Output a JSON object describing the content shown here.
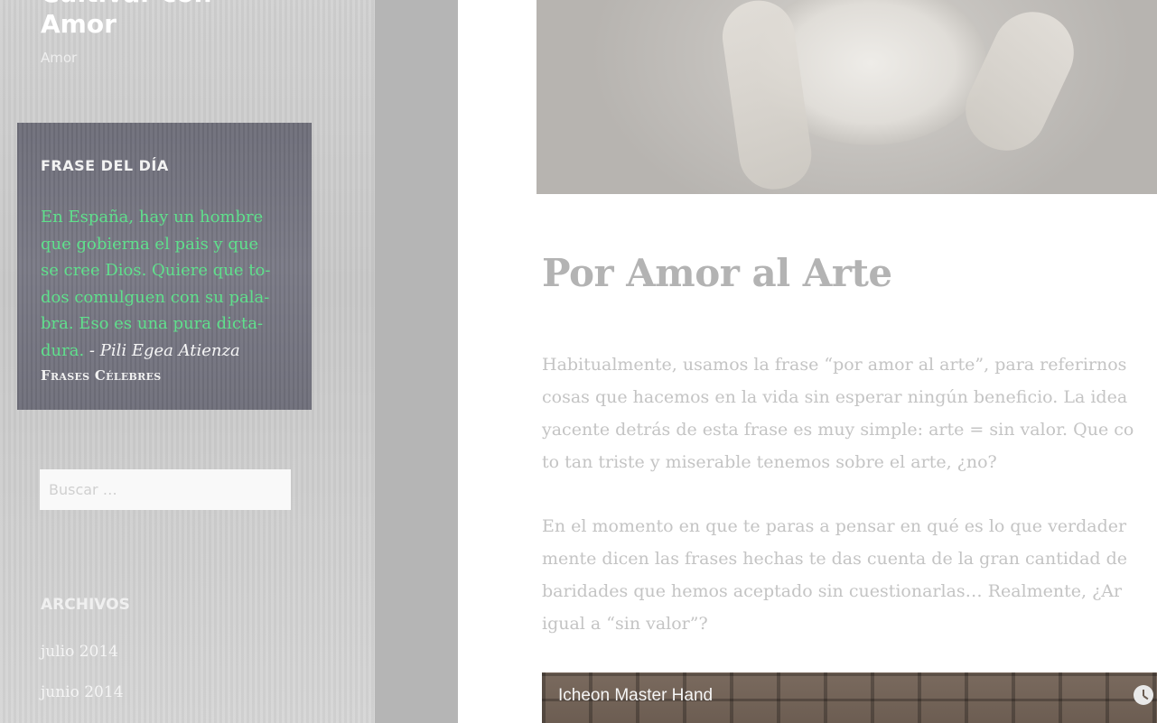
{
  "site": {
    "title_line1": "Cultivar con",
    "title_line2": "Amor",
    "description": "Amor"
  },
  "quote_widget": {
    "title": "FRASE DEL DÍA",
    "quote_lines": [
      "En España, hay un hombre",
      "que gobierna el pais y que",
      "se cree Dios. Quiere que to-",
      "dos comulguen con su pala-",
      "bra. Eso es una pura dicta-",
      "dura."
    ],
    "author": " - Pili Egea Atienza",
    "source": "Frases Célebres"
  },
  "search": {
    "placeholder": "Buscar …"
  },
  "archives": {
    "title": "ARCHIVOS",
    "items": [
      "julio 2014",
      "junio 2014"
    ]
  },
  "post": {
    "title": "Por Amor al Arte",
    "paragraph1_lines": [
      "Habitualmente, usamos la frase “por amor al arte”, para referirnos",
      "cosas que hacemos en la vida sin esperar ningún beneficio. La idea",
      "yacente detrás de esta frase es muy simple: arte = sin valor. Que co",
      "to tan triste y miserable tenemos sobre el arte, ¿no?"
    ],
    "paragraph2_lines": [
      "En el momento en que te paras a pensar en qué es lo que verdader",
      "mente dicen las frases hechas te das cuenta de la gran cantidad de",
      "baridades que hemos aceptado sin cuestionarlas…  Realmente, ¿Ar",
      "igual a “sin valor”?"
    ],
    "video_title": "Icheon Master Hand"
  },
  "colors": {
    "quote_text": "#5fe08c",
    "title_gray": "#b3b3b3",
    "body_gray": "#c4c4c4"
  }
}
